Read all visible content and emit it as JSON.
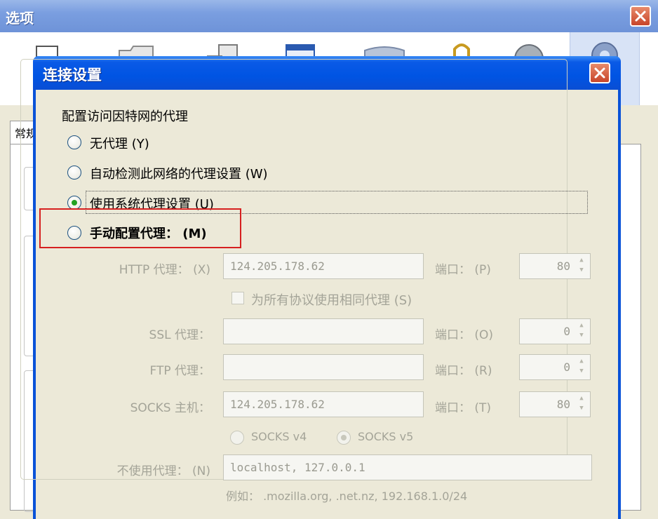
{
  "background_window": {
    "title": "选项",
    "tab_partial": "常规"
  },
  "dialog": {
    "title": "连接设置",
    "group_label": "配置访问因特网的代理",
    "options": [
      {
        "label": "无代理 (Y)",
        "checked": false
      },
      {
        "label": "自动检测此网络的代理设置 (W)",
        "checked": false
      },
      {
        "label": "使用系统代理设置 (U)",
        "checked": true
      },
      {
        "label": "手动配置代理： (M)",
        "checked": false
      }
    ],
    "http": {
      "label": "HTTP 代理： (X)",
      "value": "124.205.178.62",
      "port_label": "端口： (P)",
      "port": "80"
    },
    "same_proxy_checkbox": "为所有协议使用相同代理 (S)",
    "ssl": {
      "label": "SSL 代理：",
      "value": "",
      "port_label": "端口： (O)",
      "port": "0"
    },
    "ftp": {
      "label": "FTP 代理：",
      "value": "",
      "port_label": "端口： (R)",
      "port": "0"
    },
    "socks": {
      "label": "SOCKS 主机：",
      "value": "124.205.178.62",
      "port_label": "端口： (T)",
      "port": "80"
    },
    "socks_v4": {
      "label": "SOCKS v4",
      "checked": false
    },
    "socks_v5": {
      "label": "SOCKS v5",
      "checked": true
    },
    "no_proxy": {
      "label": "不使用代理： (N)",
      "value": "localhost, 127.0.0.1"
    },
    "example": "例如： .mozilla.org, .net.nz, 192.168.1.0/24"
  },
  "colors": {
    "titlebar": "#0054e3",
    "dialog_bg": "#ece9d8",
    "highlight_box": "#d62020",
    "close_button": "#c8452a"
  }
}
